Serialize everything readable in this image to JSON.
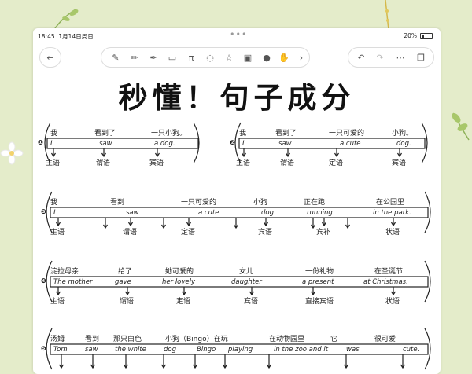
{
  "status": {
    "time": "18:45",
    "date": "1月14日周日",
    "battery": "20%"
  },
  "toolbar": {
    "back_icon": "chevron-left-icon",
    "tools": [
      "pen-icon",
      "pencil-icon",
      "marker-icon",
      "eraser-icon",
      "lasso-icon",
      "shape-icon",
      "image-icon",
      "mic-icon",
      "gesture-icon",
      "chevron-right-icon"
    ],
    "right_tools": [
      "undo-icon",
      "redo-icon",
      "more-icon",
      "pages-icon"
    ]
  },
  "title": "秒懂！句子成分",
  "sentences": [
    {
      "num": "❶",
      "cn": [
        "我",
        "看到了",
        "一只小狗。"
      ],
      "en": [
        "I",
        "saw",
        "a dog."
      ],
      "roles": [
        "主语",
        "谓语",
        "宾语"
      ]
    },
    {
      "num": "❷",
      "cn": [
        "我",
        "看到了",
        "一只可爱的",
        "小狗。"
      ],
      "en": [
        "I",
        "saw",
        "a cute",
        "dog."
      ],
      "roles": [
        "主语",
        "谓语",
        "定语",
        "宾语"
      ]
    },
    {
      "num": "❸",
      "cn": [
        "我",
        "看到",
        "一只可爱的",
        "小狗",
        "正在跑",
        "在公园里"
      ],
      "en": [
        "I",
        "saw",
        "a cute",
        "dog",
        "running",
        "in the park."
      ],
      "roles": [
        "主语",
        "谓语",
        "定语",
        "宾语",
        "宾补",
        "状语"
      ]
    },
    {
      "num": "❹",
      "cn": [
        "淀拉母亲",
        "给了",
        "她可爱的",
        "女儿",
        "一份礼物",
        "在圣诞节"
      ],
      "en": [
        "The mother",
        "gave",
        "her lovely",
        "daughter",
        "a present",
        "at Christmas."
      ],
      "roles": [
        "主语",
        "谓语",
        "定语",
        "宾语",
        "直接宾语",
        "状语"
      ]
    },
    {
      "num": "❺",
      "cn": [
        "汤姆",
        "看到",
        "那只白色",
        "小狗（Bingo）在玩",
        "在动物园里",
        "它",
        "很可爱"
      ],
      "en": [
        "Tom",
        "saw",
        "the white",
        "dog",
        "Bingo",
        "playing",
        "in the zoo and it",
        "was",
        "cute."
      ],
      "roles": []
    }
  ],
  "colors": {
    "ink": "#222222",
    "paper": "#ffffff",
    "background": "#e4ecca",
    "leaf": "#8fb25a"
  }
}
